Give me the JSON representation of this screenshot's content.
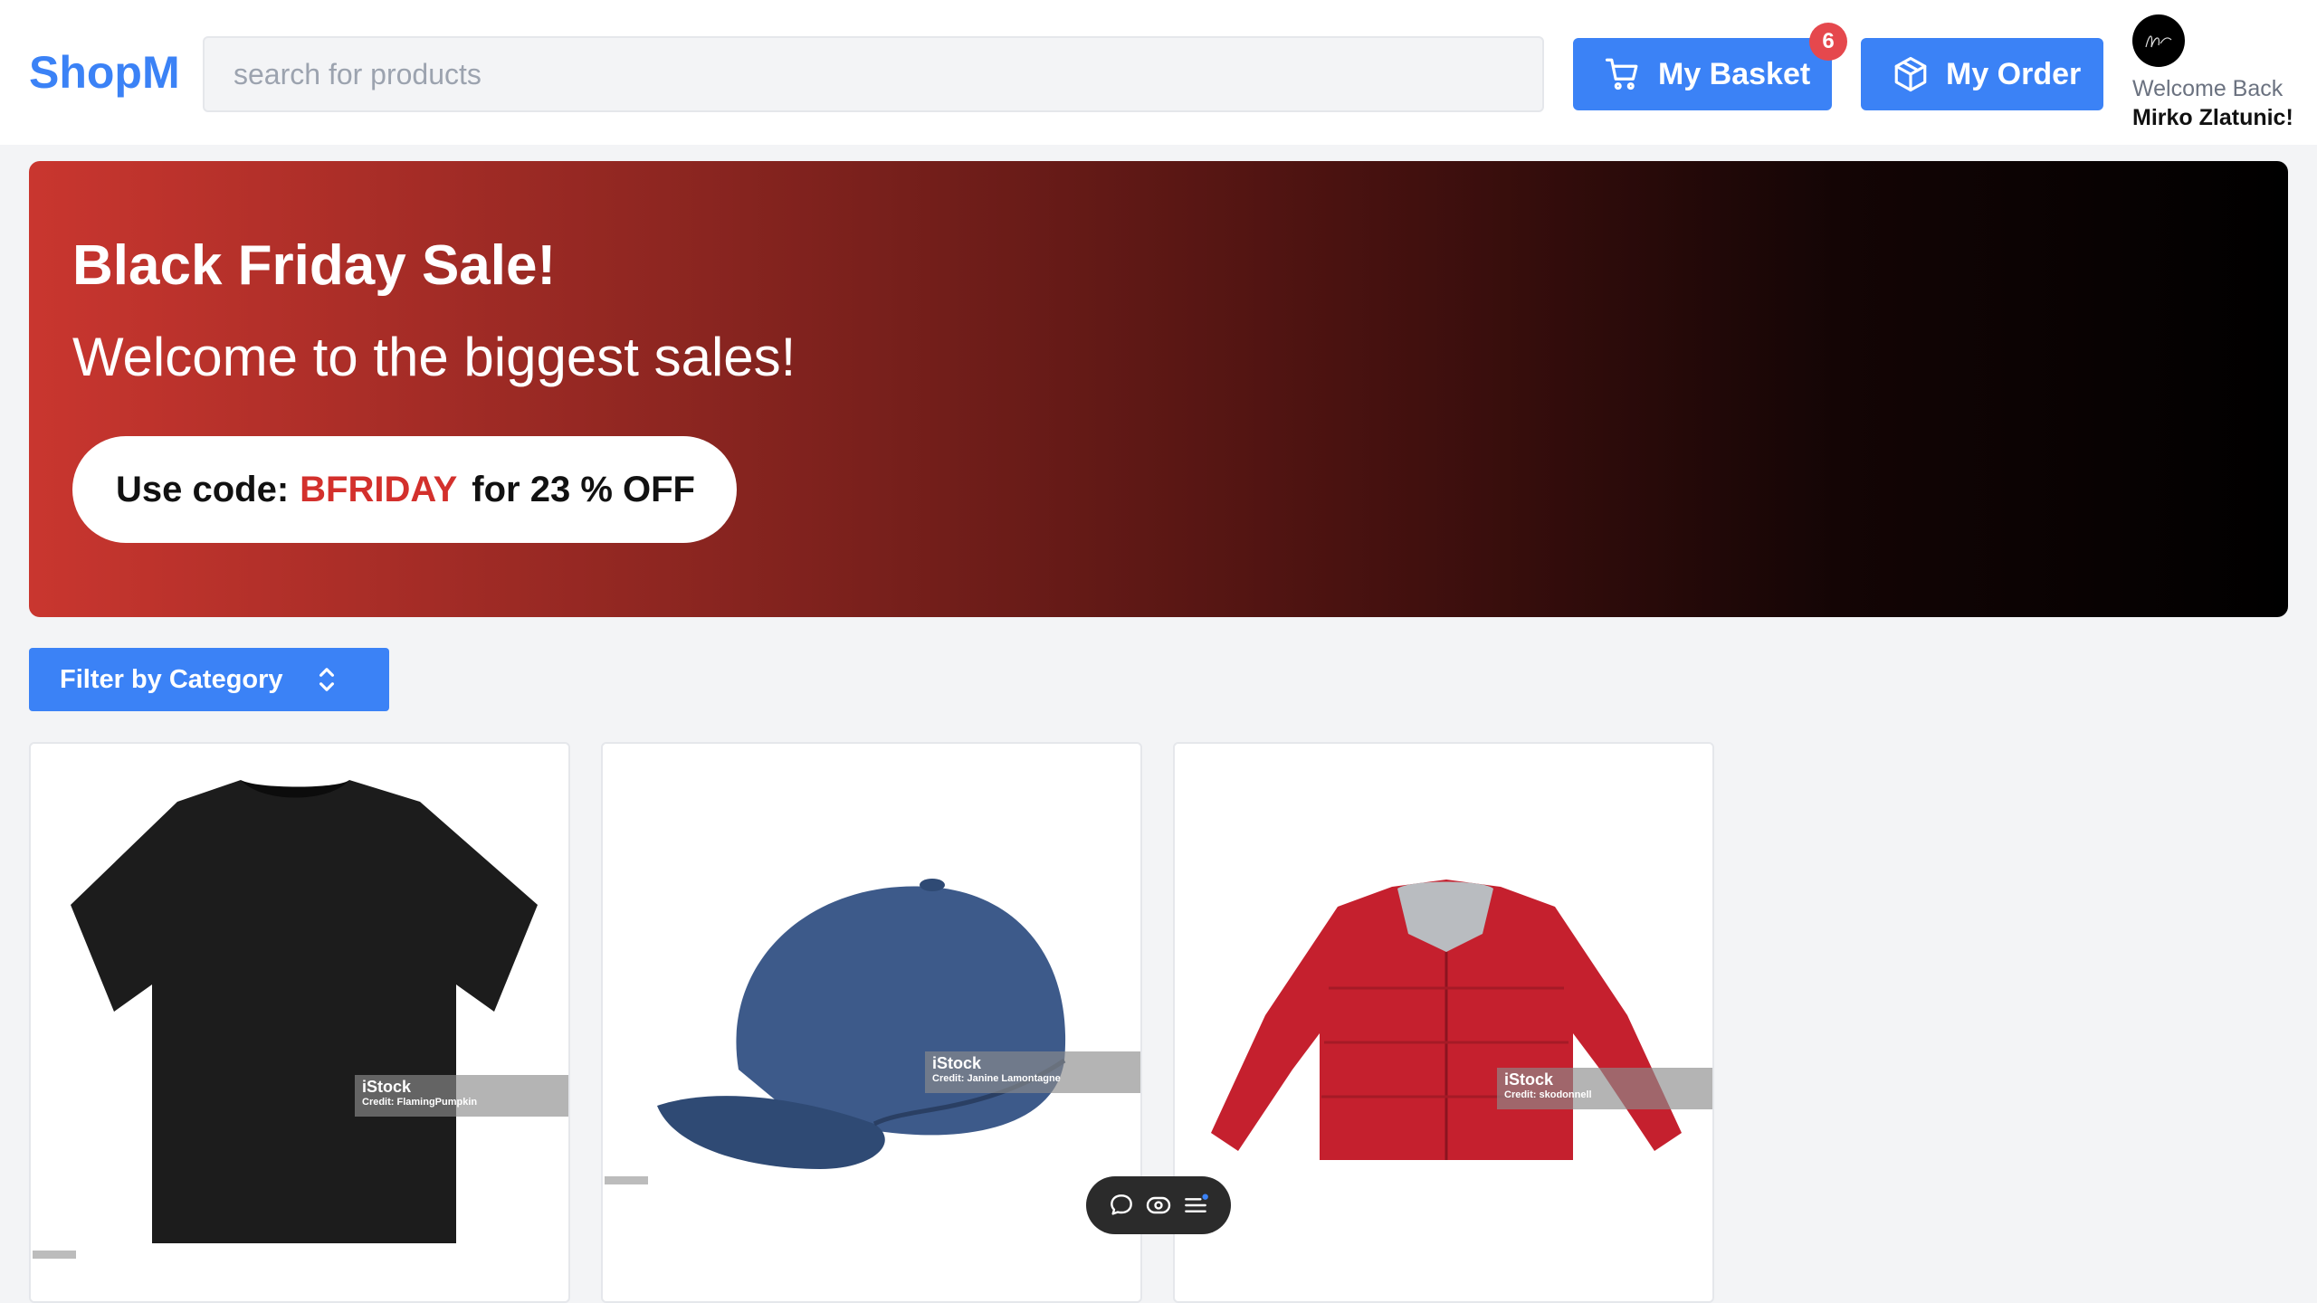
{
  "header": {
    "logo": "ShopM",
    "search": {
      "placeholder": "search for products",
      "value": ""
    },
    "basket": {
      "label": "My Basket",
      "icon": "cart-icon",
      "count": "6"
    },
    "order": {
      "label": "My Order",
      "icon": "package-icon"
    },
    "user": {
      "avatar": "signature-avatar",
      "welcome": "Welcome Back",
      "name": "Mirko Zlatunic!"
    }
  },
  "banner": {
    "title": "Black Friday Sale!",
    "subtitle": "Welcome to the biggest sales!",
    "promo": {
      "prefix": "Use code:",
      "code": "BFRIDAY",
      "suffix": "for 23 % OFF"
    },
    "colors": {
      "start": "#c9362f",
      "end": "#000000",
      "code": "#d3302c"
    }
  },
  "filter": {
    "label": "Filter by Category",
    "icon": "chevron-up-down-icon"
  },
  "products": [
    {
      "name": "black t-shirt",
      "watermark": {
        "brand": "iStock",
        "credit": "Credit: FlamingPumpkin"
      }
    },
    {
      "name": "navy baseball cap",
      "watermark": {
        "brand": "iStock",
        "credit": "Credit: Janine Lamontagne"
      }
    },
    {
      "name": "red puffer jacket",
      "watermark": {
        "brand": "iStock",
        "credit": "Credit: skodonnell"
      }
    }
  ],
  "toolbar": {
    "icons": [
      "comment-icon",
      "eye-icon",
      "menu-icon"
    ]
  },
  "theme": {
    "accent": "#3b82f6",
    "badge": "#e5484d",
    "page_bg": "#f3f4f6"
  }
}
